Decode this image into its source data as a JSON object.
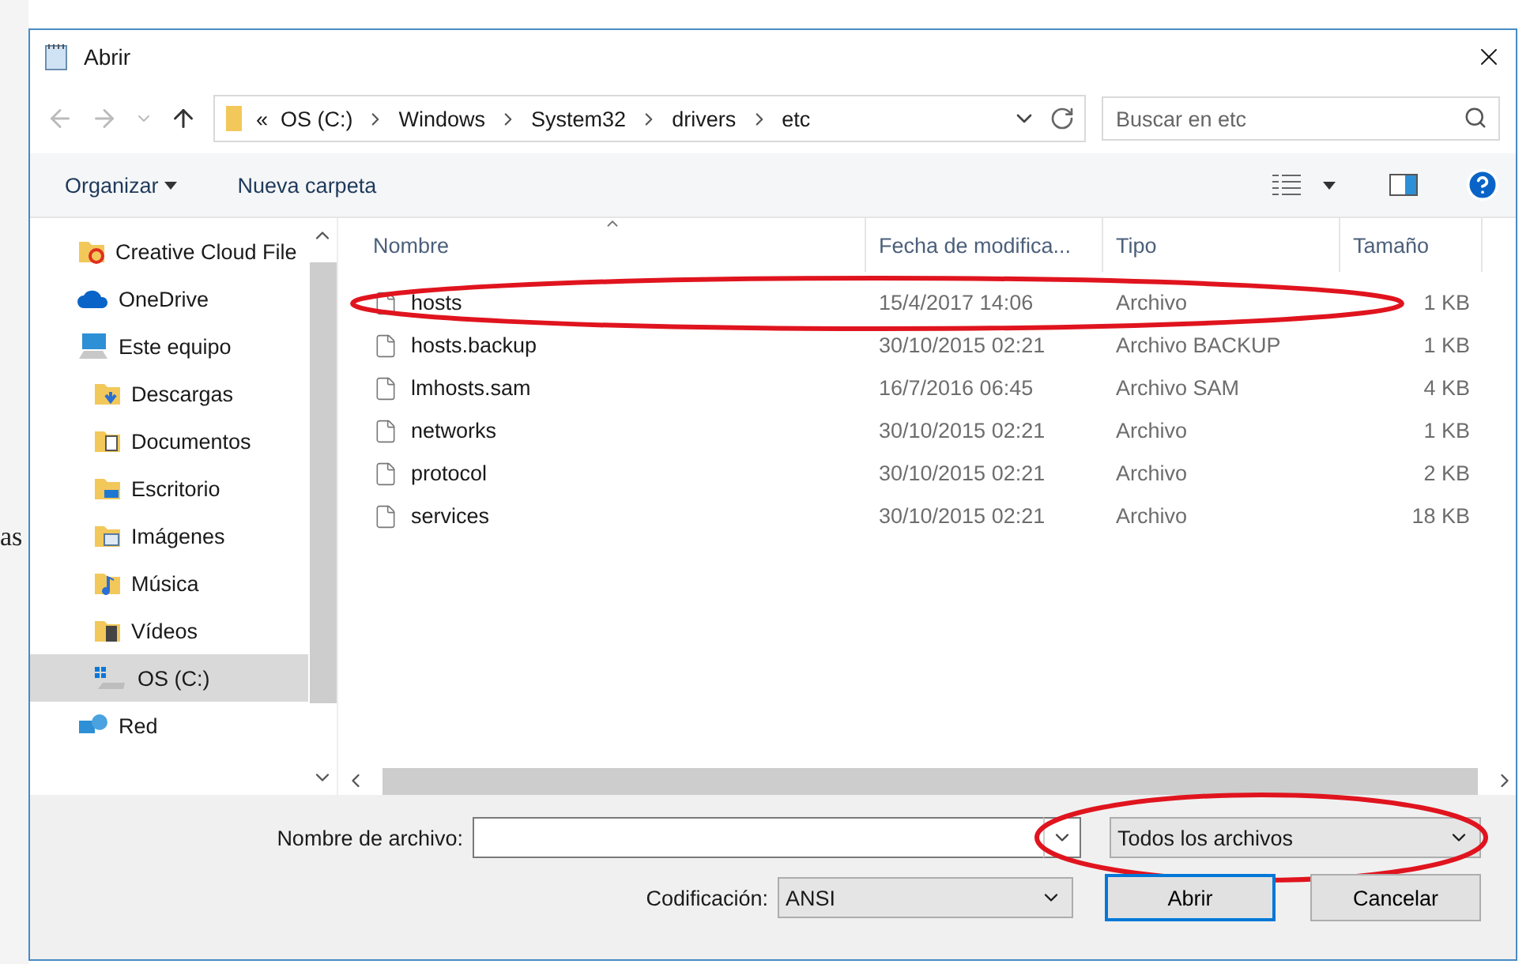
{
  "background_text": "as",
  "window": {
    "title": "Abrir"
  },
  "address_bar": {
    "overflow": "«",
    "segments": [
      "OS (C:)",
      "Windows",
      "System32",
      "drivers",
      "etc"
    ]
  },
  "search": {
    "placeholder": "Buscar en etc"
  },
  "toolbar": {
    "organize": "Organizar",
    "new_folder": "Nueva carpeta"
  },
  "sidebar": {
    "items": [
      {
        "label": "Creative Cloud File",
        "kind": "cloud-files",
        "selected": false
      },
      {
        "label": "OneDrive",
        "kind": "onedrive",
        "selected": false
      },
      {
        "label": "Este equipo",
        "kind": "pc",
        "selected": false,
        "children": [
          {
            "label": "Descargas",
            "kind": "downloads",
            "selected": false
          },
          {
            "label": "Documentos",
            "kind": "documents",
            "selected": false
          },
          {
            "label": "Escritorio",
            "kind": "desktop",
            "selected": false
          },
          {
            "label": "Imágenes",
            "kind": "pictures",
            "selected": false
          },
          {
            "label": "Música",
            "kind": "music",
            "selected": false
          },
          {
            "label": "Vídeos",
            "kind": "videos",
            "selected": false
          },
          {
            "label": "OS (C:)",
            "kind": "drive",
            "selected": true
          }
        ]
      },
      {
        "label": "Red",
        "kind": "network",
        "selected": false
      }
    ]
  },
  "table": {
    "columns": [
      {
        "label": "Nombre",
        "sorted": true
      },
      {
        "label": "Fecha de modifica...",
        "sorted": false
      },
      {
        "label": "Tipo",
        "sorted": false
      },
      {
        "label": "Tamaño",
        "sorted": false
      }
    ],
    "rows": [
      {
        "cells": [
          "hosts",
          "15/4/2017 14:06",
          "Archivo",
          "1 KB"
        ],
        "circled": true
      },
      {
        "cells": [
          "hosts.backup",
          "30/10/2015 02:21",
          "Archivo BACKUP",
          "1 KB"
        ],
        "circled": false
      },
      {
        "cells": [
          "lmhosts.sam",
          "16/7/2016 06:45",
          "Archivo SAM",
          "4 KB"
        ],
        "circled": false
      },
      {
        "cells": [
          "networks",
          "30/10/2015 02:21",
          "Archivo",
          "1 KB"
        ],
        "circled": false
      },
      {
        "cells": [
          "protocol",
          "30/10/2015 02:21",
          "Archivo",
          "2 KB"
        ],
        "circled": false
      },
      {
        "cells": [
          "services",
          "30/10/2015 02:21",
          "Archivo",
          "18 KB"
        ],
        "circled": false
      }
    ]
  },
  "filename": {
    "label": "Nombre de archivo:"
  },
  "file_type": {
    "value": "Todos los archivos",
    "circled": true
  },
  "encoding": {
    "label": "Codificación:",
    "value": "ANSI"
  },
  "buttons": [
    {
      "label": "Abrir",
      "default": true
    },
    {
      "label": "Cancelar",
      "default": false
    }
  ]
}
